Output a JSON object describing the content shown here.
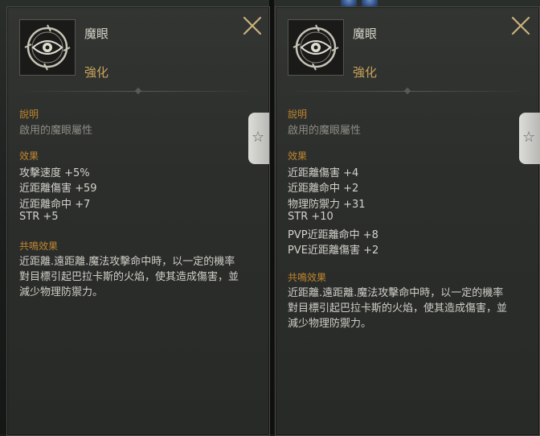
{
  "panels": [
    {
      "item_name": "魔眼",
      "item_grade": "強化",
      "description_label": "說明",
      "description": "啟用的魔眼屬性",
      "effects_label": "效果",
      "effects": [
        "攻擊速度 +5%",
        "近距離傷害 +59",
        "近距離命中 +7",
        "STR +5"
      ],
      "set_label": "共鳴效果",
      "set_lines": [
        "近距離.遠距離.魔法攻擊命中時，以一定的機率",
        "對目標引起巴拉卡斯的火焰，使其造成傷害，並",
        "減少物理防禦力。"
      ]
    },
    {
      "item_name": "魔眼",
      "item_grade": "強化",
      "description_label": "說明",
      "description": "啟用的魔眼屬性",
      "effects_label": "效果",
      "effects": [
        "近距離傷害 +4",
        "近距離命中 +2",
        "物理防禦力 +31",
        "STR +10",
        "PVP近距離命中 +8",
        "PVE近距離傷害 +2"
      ],
      "set_label": "共鳴效果",
      "set_lines": [
        "近距離.遠距離.魔法攻擊命中時，以一定的機率",
        "對目標引起巴拉卡斯的火焰，使其造成傷害，並",
        "減少物理防禦力。"
      ]
    }
  ],
  "icons": {
    "item": "eye-emblem-icon",
    "close": "close-x-icon",
    "side_tab": "star-icon"
  },
  "colors": {
    "section_label": "#c0862e",
    "grade": "#c9a35a",
    "stat_text": "#d4d2cb",
    "description_text": "#8e8c85",
    "close_icon": "#c8b27c"
  }
}
